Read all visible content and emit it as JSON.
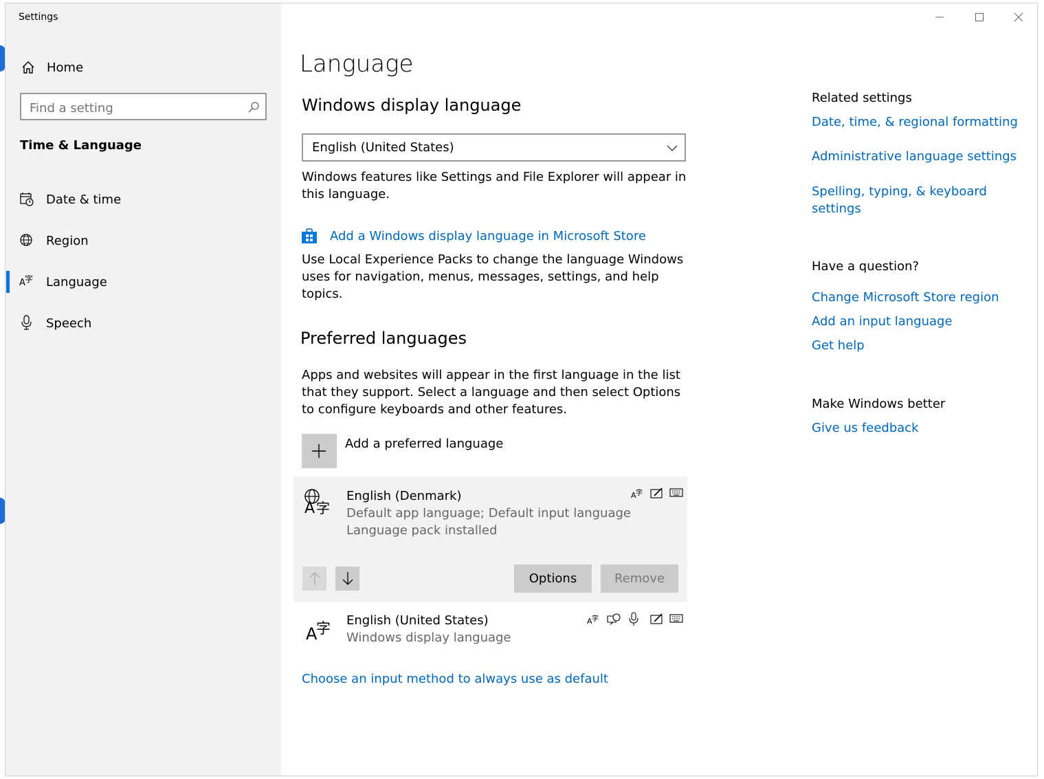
{
  "window": {
    "title": "Settings"
  },
  "sidebar": {
    "home_label": "Home",
    "search_placeholder": "Find a setting",
    "section_title": "Time & Language",
    "items": [
      {
        "label": "Date & time",
        "icon": "calendar-clock-icon"
      },
      {
        "label": "Region",
        "icon": "globe-icon"
      },
      {
        "label": "Language",
        "icon": "language-icon",
        "selected": true
      },
      {
        "label": "Speech",
        "icon": "microphone-icon"
      }
    ]
  },
  "main": {
    "page_title": "Language",
    "display_language": {
      "heading": "Windows display language",
      "selected": "English (United States)",
      "description": "Windows features like Settings and File Explorer will appear in this language.",
      "store_link": "Add a Windows display language in Microsoft Store",
      "store_description": "Use Local Experience Packs to change the language Windows uses for navigation, menus, messages, settings, and help topics."
    },
    "preferred": {
      "heading": "Preferred languages",
      "description": "Apps and websites will appear in the first language in the list that they support. Select a language and then select Options to configure keyboards and other features.",
      "add_label": "Add a preferred language",
      "languages": [
        {
          "name": "English (Denmark)",
          "line1": "Default app language; Default input language",
          "line2": "Language pack installed",
          "options_label": "Options",
          "remove_label": "Remove"
        },
        {
          "name": "English (United States)",
          "line1": "Windows display language"
        }
      ],
      "input_method_link": "Choose an input method to always use as default"
    }
  },
  "related": {
    "heading": "Related settings",
    "links": [
      "Date, time, & regional formatting",
      "Administrative language settings",
      "Spelling, typing, & keyboard settings"
    ],
    "question_heading": "Have a question?",
    "question_links": [
      "Change Microsoft Store region",
      "Add an input language",
      "Get help"
    ],
    "better_heading": "Make Windows better",
    "feedback_link": "Give us feedback"
  },
  "colors": {
    "accent": "#0067b8",
    "sidebar_bg": "#f2f2f2",
    "selected_indicator": "#0078d7"
  }
}
